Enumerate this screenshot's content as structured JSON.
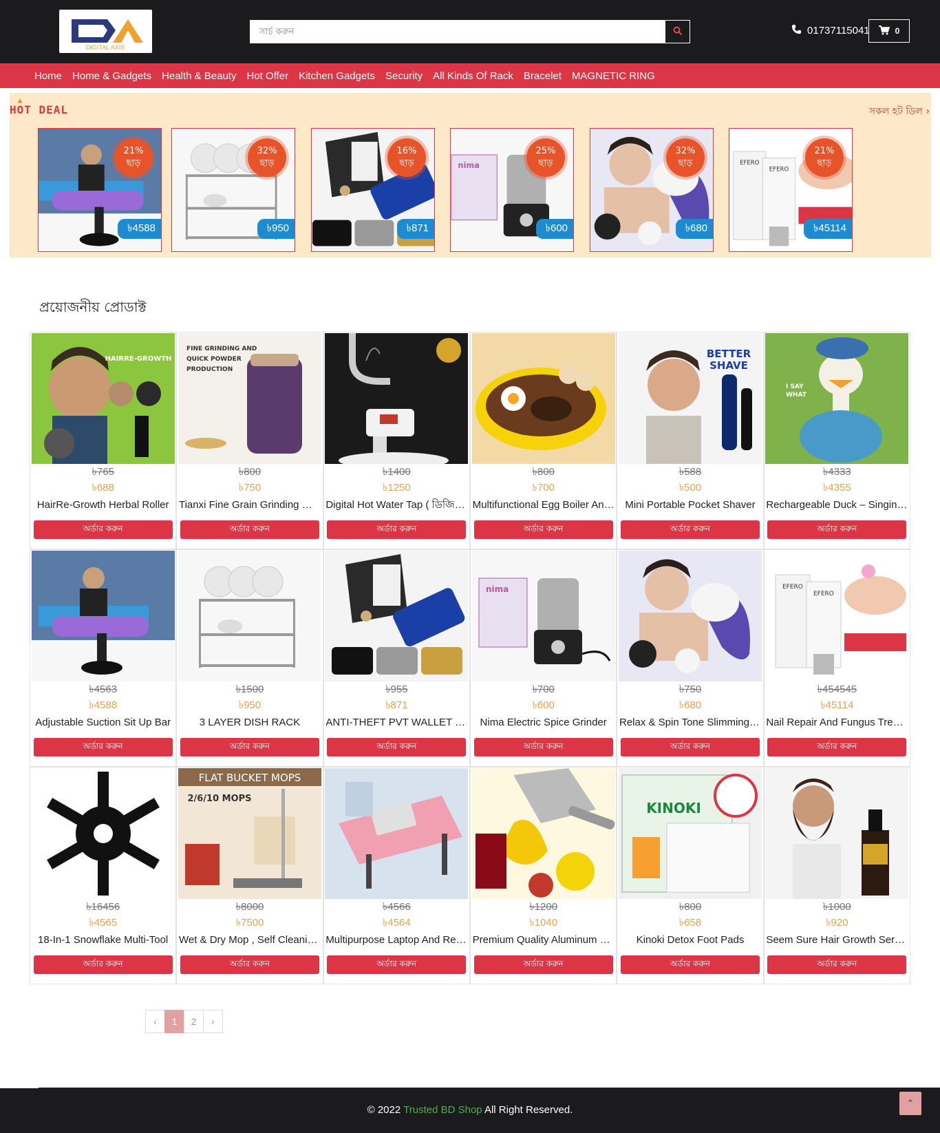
{
  "header": {
    "logo_text": "DIGITAL AXIS",
    "search_placeholder": "সার্চ করুন",
    "phone": "01737115041",
    "cart_count": "0"
  },
  "nav": {
    "items": [
      "Home",
      "Home & Gadgets",
      "Health & Beauty",
      "Hot Offer",
      "Kitchen Gadgets",
      "Security",
      "All Kinds Of Rack",
      "Bracelet",
      "MAGNETIC RING"
    ]
  },
  "hot_deal": {
    "title": "HOT DEAL",
    "see_all": "সকল হট ডিল ›",
    "badge_suffix": "ছাড়",
    "deals": [
      {
        "discount": "21%",
        "price": "৳4588",
        "image": "situp-bar"
      },
      {
        "discount": "32%",
        "price": "৳950",
        "image": "dish-rack"
      },
      {
        "discount": "16%",
        "price": "৳871",
        "image": "wallet"
      },
      {
        "discount": "25%",
        "price": "৳600",
        "image": "spice-grinder"
      },
      {
        "discount": "32%",
        "price": "৳680",
        "image": "massager"
      },
      {
        "discount": "21%",
        "price": "৳45114",
        "image": "nail-repair"
      }
    ]
  },
  "products_section": {
    "title": "প্রয়োজনীয় প্রোডাক্ট",
    "order_label": "অর্ডার করুন",
    "products": [
      {
        "name": "HairRe-Growth Herbal Roller",
        "old_price": "৳765",
        "price": "৳688",
        "image": "hair-roller"
      },
      {
        "name": "Tianxi Fine Grain Grinding Machine",
        "old_price": "৳800",
        "price": "৳750",
        "image": "grinder-purple"
      },
      {
        "name": "Digital Hot Water Tap ( ডিজিটাল )",
        "old_price": "৳1400",
        "price": "৳1250",
        "image": "water-tap"
      },
      {
        "name": "Multifunctional Egg Boiler And Fry Pan",
        "old_price": "৳800",
        "price": "৳700",
        "image": "egg-boiler"
      },
      {
        "name": "Mini Portable Pocket Shaver",
        "old_price": "৳588",
        "price": "৳500",
        "image": "shaver"
      },
      {
        "name": "Rechargeable Duck – Singing Toy",
        "old_price": "৳4333",
        "price": "৳4355",
        "image": "duck-toy"
      },
      {
        "name": "Adjustable Suction Sit Up Bar",
        "old_price": "৳4563",
        "price": "৳4588",
        "image": "situp-bar"
      },
      {
        "name": "3 LAYER DISH RACK",
        "old_price": "৳1500",
        "price": "৳950",
        "image": "dish-rack"
      },
      {
        "name": "ANTI-THEFT PVT WALLET CLIP",
        "old_price": "৳955",
        "price": "৳871",
        "image": "wallet"
      },
      {
        "name": "Nima Electric Spice Grinder",
        "old_price": "৳700",
        "price": "৳600",
        "image": "spice-grinder"
      },
      {
        "name": "Relax & Spin Tone Slimming Massager",
        "old_price": "৳750",
        "price": "৳680",
        "image": "massager"
      },
      {
        "name": "Nail Repair And Fungus Treatment",
        "old_price": "৳454545",
        "price": "৳45114",
        "image": "nail-repair"
      },
      {
        "name": "18-In-1 Snowflake Multi-Tool",
        "old_price": "৳16456",
        "price": "৳4565",
        "image": "snowflake-tool"
      },
      {
        "name": "Wet & Dry Mop , Self Cleaning Mop",
        "old_price": "৳8000",
        "price": "৳7500",
        "image": "mop"
      },
      {
        "name": "Multipurpose Laptop And Reading Table",
        "old_price": "৳4566",
        "price": "৳4564",
        "image": "laptop-table"
      },
      {
        "name": "Premium Quality Aluminum Juicer",
        "old_price": "৳1200",
        "price": "৳1040",
        "image": "juicer"
      },
      {
        "name": "Kinoki Detox Foot Pads",
        "old_price": "৳800",
        "price": "৳658",
        "image": "kinoki"
      },
      {
        "name": "Seem Sure Hair Growth Serum",
        "old_price": "৳1000",
        "price": "৳920",
        "image": "beard-oil"
      }
    ]
  },
  "pagination": {
    "prev": "‹",
    "pages": [
      "1",
      "2"
    ],
    "next": "›",
    "current": "1"
  },
  "footer": {
    "prefix": "© 2022",
    "brand": "Trusted BD Shop",
    "suffix": "All Right Reserved."
  },
  "colors": {
    "header_bg": "#1b1b1d",
    "accent": "#dc3545",
    "hot_deal_bg": "#fde8c8",
    "price_orange": "#f0a04a",
    "price_tag_blue": "#1e8ad0"
  }
}
